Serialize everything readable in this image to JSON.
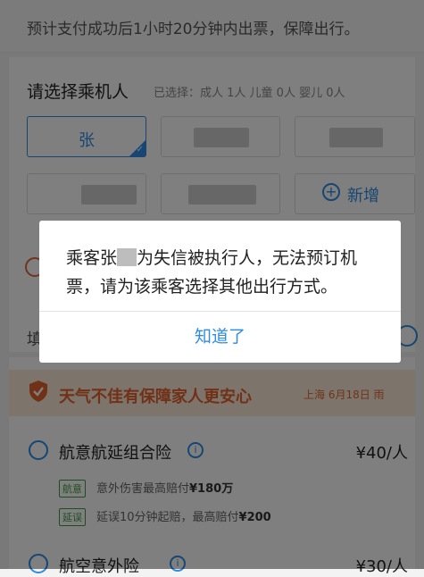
{
  "notice": {
    "text": "预计支付成功后1小时20分钟内出票，保障出行。"
  },
  "passenger_section": {
    "title": "请选择乘机人",
    "selected_summary": "已选择：成人 1人 儿童 0人 婴儿 0人",
    "selected_passenger": "张",
    "add_label": "新增"
  },
  "insurance": {
    "banner": "天气不佳有保障家人更安心",
    "location_date": "上海 6月18日 雨",
    "items": [
      {
        "title": "航意航延组合险",
        "price": "¥40/人",
        "tags": [
          {
            "label": "航意",
            "desc_prefix": "意外伤害最高赔付",
            "desc_bold": "¥180万"
          },
          {
            "label": "延误",
            "desc_prefix": "延误10分钟起赔，最高赔付",
            "desc_bold": "¥200"
          }
        ]
      },
      {
        "title": "航空意外险",
        "price": "¥30/人"
      }
    ]
  },
  "dialog": {
    "message_part1": "乘客张",
    "message_part2": "为失信被执行人，无法预订机票，请为该乘客选择其他出行方式。",
    "button": "知道了"
  },
  "colors": {
    "accent": "#2d8de3",
    "warning": "#e2632f",
    "overlay": "rgba(0,0,0,0.5)"
  }
}
